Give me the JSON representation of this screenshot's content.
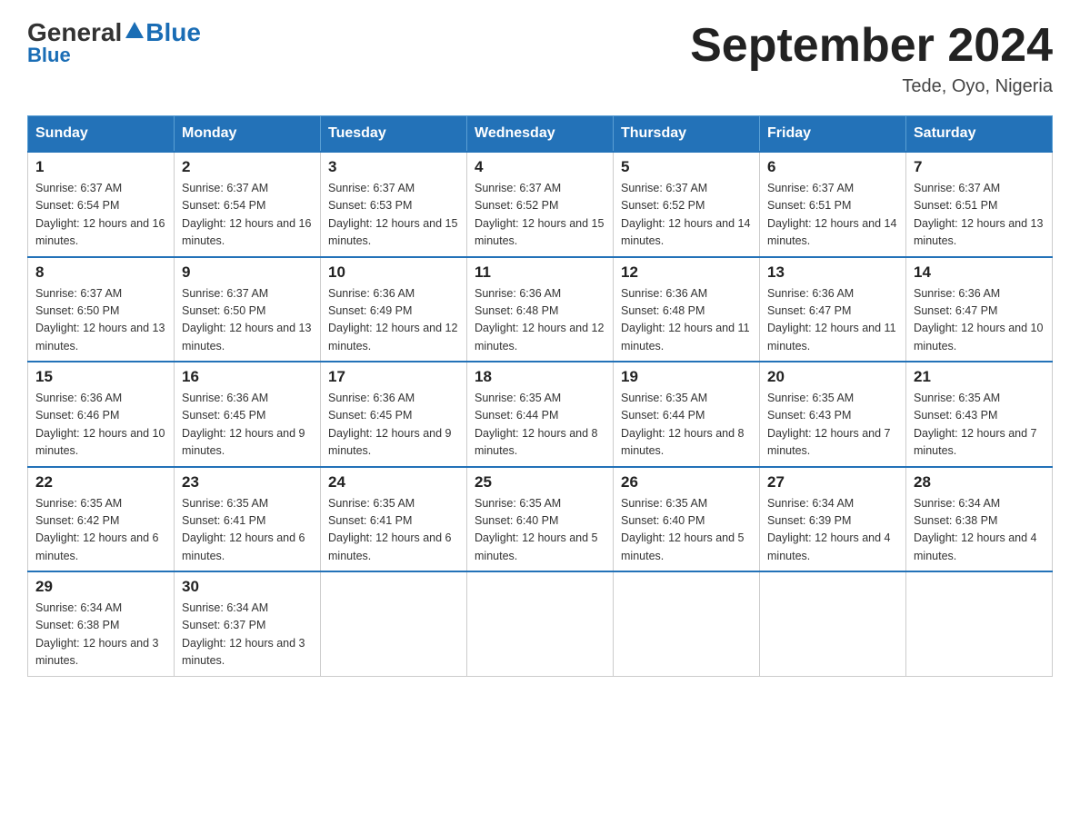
{
  "header": {
    "logo_general": "General",
    "logo_blue": "Blue",
    "title": "September 2024",
    "location": "Tede, Oyo, Nigeria"
  },
  "days_of_week": [
    "Sunday",
    "Monday",
    "Tuesday",
    "Wednesday",
    "Thursday",
    "Friday",
    "Saturday"
  ],
  "weeks": [
    [
      {
        "day": "1",
        "sunrise": "6:37 AM",
        "sunset": "6:54 PM",
        "daylight": "12 hours and 16 minutes."
      },
      {
        "day": "2",
        "sunrise": "6:37 AM",
        "sunset": "6:54 PM",
        "daylight": "12 hours and 16 minutes."
      },
      {
        "day": "3",
        "sunrise": "6:37 AM",
        "sunset": "6:53 PM",
        "daylight": "12 hours and 15 minutes."
      },
      {
        "day": "4",
        "sunrise": "6:37 AM",
        "sunset": "6:52 PM",
        "daylight": "12 hours and 15 minutes."
      },
      {
        "day": "5",
        "sunrise": "6:37 AM",
        "sunset": "6:52 PM",
        "daylight": "12 hours and 14 minutes."
      },
      {
        "day": "6",
        "sunrise": "6:37 AM",
        "sunset": "6:51 PM",
        "daylight": "12 hours and 14 minutes."
      },
      {
        "day": "7",
        "sunrise": "6:37 AM",
        "sunset": "6:51 PM",
        "daylight": "12 hours and 13 minutes."
      }
    ],
    [
      {
        "day": "8",
        "sunrise": "6:37 AM",
        "sunset": "6:50 PM",
        "daylight": "12 hours and 13 minutes."
      },
      {
        "day": "9",
        "sunrise": "6:37 AM",
        "sunset": "6:50 PM",
        "daylight": "12 hours and 13 minutes."
      },
      {
        "day": "10",
        "sunrise": "6:36 AM",
        "sunset": "6:49 PM",
        "daylight": "12 hours and 12 minutes."
      },
      {
        "day": "11",
        "sunrise": "6:36 AM",
        "sunset": "6:48 PM",
        "daylight": "12 hours and 12 minutes."
      },
      {
        "day": "12",
        "sunrise": "6:36 AM",
        "sunset": "6:48 PM",
        "daylight": "12 hours and 11 minutes."
      },
      {
        "day": "13",
        "sunrise": "6:36 AM",
        "sunset": "6:47 PM",
        "daylight": "12 hours and 11 minutes."
      },
      {
        "day": "14",
        "sunrise": "6:36 AM",
        "sunset": "6:47 PM",
        "daylight": "12 hours and 10 minutes."
      }
    ],
    [
      {
        "day": "15",
        "sunrise": "6:36 AM",
        "sunset": "6:46 PM",
        "daylight": "12 hours and 10 minutes."
      },
      {
        "day": "16",
        "sunrise": "6:36 AM",
        "sunset": "6:45 PM",
        "daylight": "12 hours and 9 minutes."
      },
      {
        "day": "17",
        "sunrise": "6:36 AM",
        "sunset": "6:45 PM",
        "daylight": "12 hours and 9 minutes."
      },
      {
        "day": "18",
        "sunrise": "6:35 AM",
        "sunset": "6:44 PM",
        "daylight": "12 hours and 8 minutes."
      },
      {
        "day": "19",
        "sunrise": "6:35 AM",
        "sunset": "6:44 PM",
        "daylight": "12 hours and 8 minutes."
      },
      {
        "day": "20",
        "sunrise": "6:35 AM",
        "sunset": "6:43 PM",
        "daylight": "12 hours and 7 minutes."
      },
      {
        "day": "21",
        "sunrise": "6:35 AM",
        "sunset": "6:43 PM",
        "daylight": "12 hours and 7 minutes."
      }
    ],
    [
      {
        "day": "22",
        "sunrise": "6:35 AM",
        "sunset": "6:42 PM",
        "daylight": "12 hours and 6 minutes."
      },
      {
        "day": "23",
        "sunrise": "6:35 AM",
        "sunset": "6:41 PM",
        "daylight": "12 hours and 6 minutes."
      },
      {
        "day": "24",
        "sunrise": "6:35 AM",
        "sunset": "6:41 PM",
        "daylight": "12 hours and 6 minutes."
      },
      {
        "day": "25",
        "sunrise": "6:35 AM",
        "sunset": "6:40 PM",
        "daylight": "12 hours and 5 minutes."
      },
      {
        "day": "26",
        "sunrise": "6:35 AM",
        "sunset": "6:40 PM",
        "daylight": "12 hours and 5 minutes."
      },
      {
        "day": "27",
        "sunrise": "6:34 AM",
        "sunset": "6:39 PM",
        "daylight": "12 hours and 4 minutes."
      },
      {
        "day": "28",
        "sunrise": "6:34 AM",
        "sunset": "6:38 PM",
        "daylight": "12 hours and 4 minutes."
      }
    ],
    [
      {
        "day": "29",
        "sunrise": "6:34 AM",
        "sunset": "6:38 PM",
        "daylight": "12 hours and 3 minutes."
      },
      {
        "day": "30",
        "sunrise": "6:34 AM",
        "sunset": "6:37 PM",
        "daylight": "12 hours and 3 minutes."
      },
      null,
      null,
      null,
      null,
      null
    ]
  ]
}
